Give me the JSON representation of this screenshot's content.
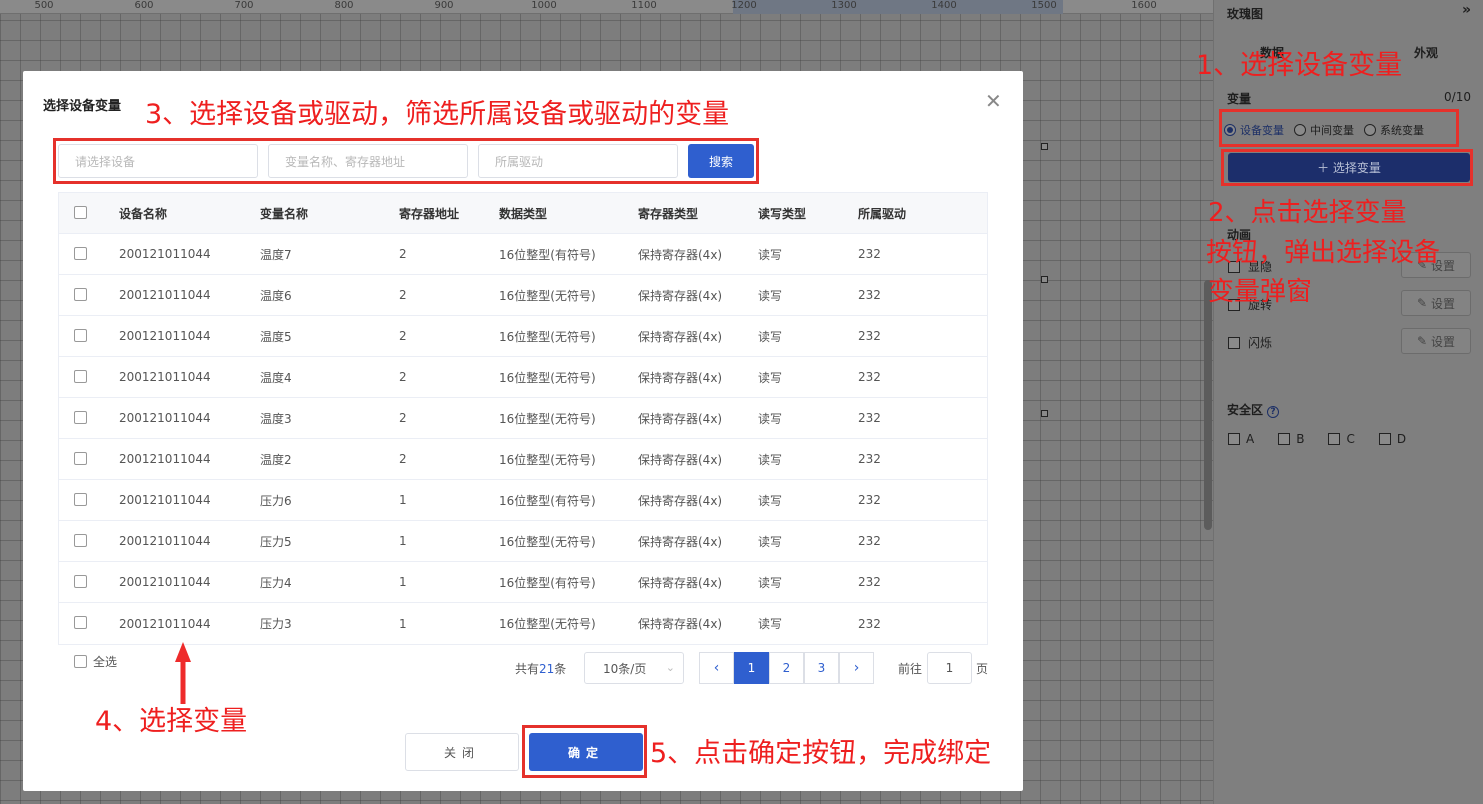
{
  "ruler": {
    "ticks": [
      "500",
      "600",
      "700",
      "800",
      "900",
      "1000",
      "1100",
      "1200",
      "1300",
      "1400",
      "1500",
      "1600"
    ]
  },
  "right_panel": {
    "title": "玫瑰图",
    "collapse_icon": "double-chevron-right-icon",
    "tabs": [
      "数据",
      "外观"
    ],
    "variable_label": "变量",
    "variable_count": "0/10",
    "radio_options": [
      "设备变量",
      "中间变量",
      "系统变量"
    ],
    "selected_radio": "设备变量",
    "select_var_button": "＋ 选择变量",
    "animation_label": "动画",
    "animations": [
      "显隐",
      "旋转",
      "闪烁"
    ],
    "set_button": "设置",
    "safe_zone_label": "安全区",
    "safe_zone_options": [
      "A",
      "B",
      "C",
      "D"
    ]
  },
  "modal": {
    "title": "选择设备变量",
    "device_placeholder": "请选择设备",
    "var_placeholder": "变量名称、寄存器地址",
    "driver_placeholder": "所属驱动",
    "search_button": "搜索",
    "columns": [
      "设备名称",
      "变量名称",
      "寄存器地址",
      "数据类型",
      "寄存器类型",
      "读写类型",
      "所属驱动"
    ],
    "rows": [
      [
        "200121011044",
        "温度7",
        "2",
        "16位整型(有符号)",
        "保持寄存器(4x)",
        "读写",
        "232"
      ],
      [
        "200121011044",
        "温度6",
        "2",
        "16位整型(无符号)",
        "保持寄存器(4x)",
        "读写",
        "232"
      ],
      [
        "200121011044",
        "温度5",
        "2",
        "16位整型(无符号)",
        "保持寄存器(4x)",
        "读写",
        "232"
      ],
      [
        "200121011044",
        "温度4",
        "2",
        "16位整型(无符号)",
        "保持寄存器(4x)",
        "读写",
        "232"
      ],
      [
        "200121011044",
        "温度3",
        "2",
        "16位整型(无符号)",
        "保持寄存器(4x)",
        "读写",
        "232"
      ],
      [
        "200121011044",
        "温度2",
        "2",
        "16位整型(无符号)",
        "保持寄存器(4x)",
        "读写",
        "232"
      ],
      [
        "200121011044",
        "压力6",
        "1",
        "16位整型(有符号)",
        "保持寄存器(4x)",
        "读写",
        "232"
      ],
      [
        "200121011044",
        "压力5",
        "1",
        "16位整型(无符号)",
        "保持寄存器(4x)",
        "读写",
        "232"
      ],
      [
        "200121011044",
        "压力4",
        "1",
        "16位整型(有符号)",
        "保持寄存器(4x)",
        "读写",
        "232"
      ],
      [
        "200121011044",
        "压力3",
        "1",
        "16位整型(无符号)",
        "保持寄存器(4x)",
        "读写",
        "232"
      ]
    ],
    "select_all": "全选",
    "pagination": {
      "total_prefix": "共有",
      "total": "21",
      "total_suffix": "条",
      "page_size": "10条/页",
      "pages": [
        "1",
        "2",
        "3"
      ],
      "current_page": "1",
      "goto_label": "前往",
      "goto_value": "1",
      "goto_unit": "页"
    },
    "close_button": "关闭",
    "ok_button": "确定"
  },
  "annotations": {
    "step1": "1、选择设备变量",
    "step2_line1": "2、点击选择变量",
    "step2_line2": "按钮，弹出选择设备",
    "step2_line3": "变量弹窗",
    "step3": "3、选择设备或驱动，筛选所属设备或驱动的变量",
    "step4": "4、选择变量",
    "step5": "5、点击确定按钮，完成绑定"
  },
  "colors": {
    "primary": "#2f5fcf",
    "annotation_red": "#ee1f1f",
    "overlay_gray": "#7f7f7f"
  }
}
